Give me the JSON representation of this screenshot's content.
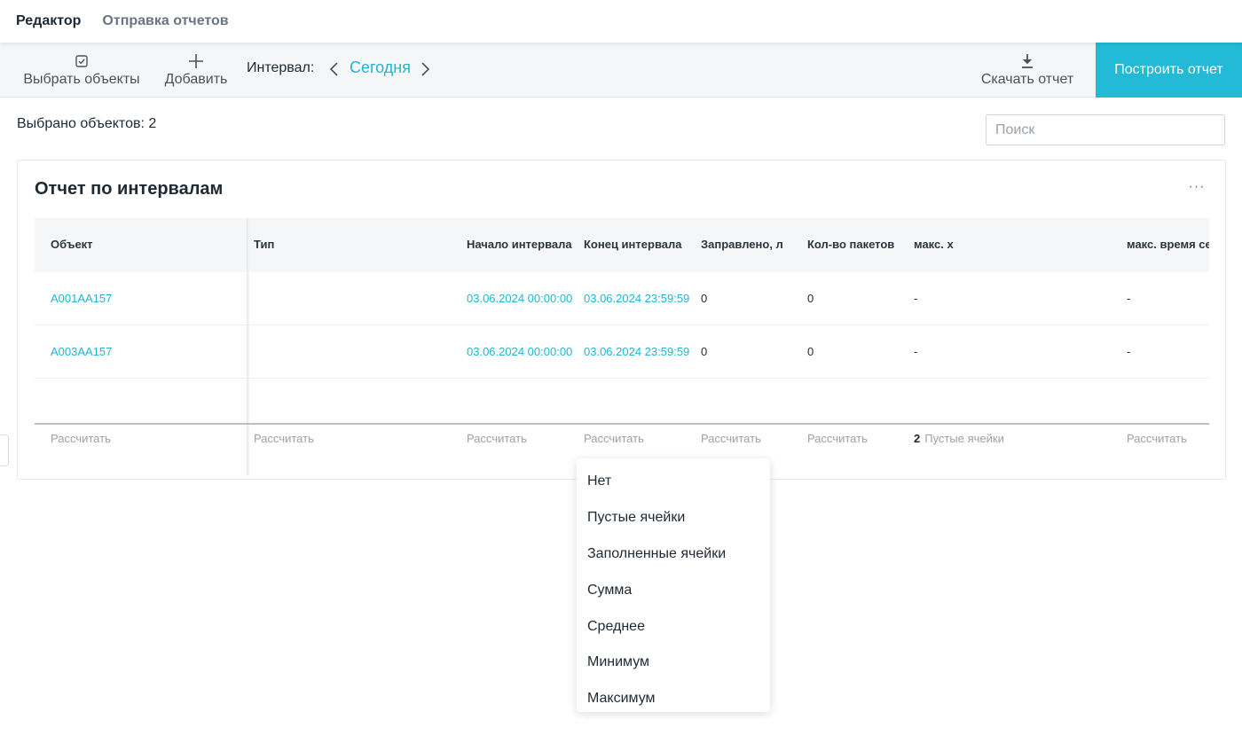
{
  "tabs": [
    {
      "label": "Редактор"
    },
    {
      "label": "Отправка отчетов"
    }
  ],
  "toolbar": {
    "select_objects": "Выбрать объекты",
    "add": "Добавить",
    "interval_label": "Интервал:",
    "interval_value": "Сегодня",
    "download": "Скачать отчет",
    "build": "Построить отчет"
  },
  "selected_count": "Выбрано объектов: 2",
  "search": {
    "placeholder": "Поиск",
    "value": ""
  },
  "report": {
    "title": "Отчет по интервалам",
    "more": "···",
    "columns": [
      "Объект",
      "Тип",
      "Начало интервала",
      "Конец интервала",
      "Заправлено, л",
      "Кол-во пакетов",
      "макс. х",
      "макс. время сер"
    ],
    "rows": [
      [
        "A001AA157",
        "",
        "03.06.2024 00:00:00",
        "03.06.2024 23:59:59",
        "0",
        "0",
        "-",
        "-"
      ],
      [
        "A003AA157",
        "",
        "03.06.2024 00:00:00",
        "03.06.2024 23:59:59",
        "0",
        "0",
        "-",
        "-"
      ]
    ],
    "footer": {
      "calc_label": "Рассчитать",
      "active_count": "2",
      "active_label": "Пустые ячейки"
    }
  },
  "dropdown": {
    "options": [
      "Нет",
      "Пустые ячейки",
      "Заполненные ячейки",
      "Сумма",
      "Среднее",
      "Минимум",
      "Максимум"
    ]
  },
  "colors": {
    "accent": "#22bad6",
    "link": "#23b4cf",
    "toolbar_bg": "#f5f6f7",
    "header_bg": "#f5f6f7"
  },
  "icons": {
    "select_objects": "checkbox-icon",
    "add": "plus-icon",
    "prev": "chevron-left-icon",
    "next": "chevron-right-icon",
    "download": "download-icon",
    "more": "ellipsis-icon"
  }
}
